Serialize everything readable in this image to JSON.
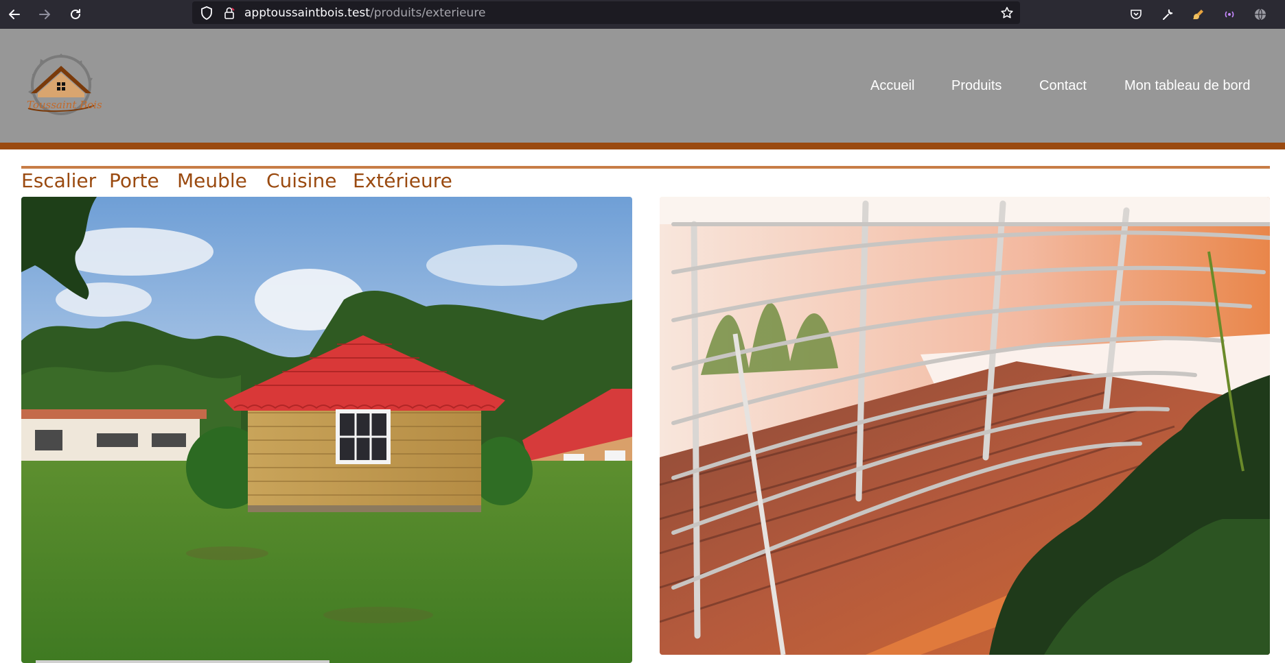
{
  "browser": {
    "url_host": "apptoussaintbois.test",
    "url_path": "/produits/exterieure",
    "icons": [
      "back-icon",
      "forward-icon",
      "reload-icon",
      "shield-icon",
      "lock-icon",
      "star-icon",
      "pocket-icon",
      "wrench-icon",
      "brush-icon",
      "broadcast-icon",
      "globe-icon"
    ]
  },
  "site": {
    "logo_text": "Toussaint Bois",
    "accent_color": "#9a4a10",
    "header_bg": "#979797"
  },
  "main_nav": {
    "home": "Accueil",
    "products": "Produits",
    "contact": "Contact",
    "dashboard": "Mon tableau de bord"
  },
  "categories": {
    "stairs": "Escalier",
    "door": "Porte",
    "furniture": "Meuble",
    "kitchen": "Cuisine",
    "exterior": "Extérieure"
  },
  "products": [
    {
      "image_subject": "wooden-cabin-red-roof"
    },
    {
      "image_subject": "wooden-deck-steel-railing"
    }
  ]
}
